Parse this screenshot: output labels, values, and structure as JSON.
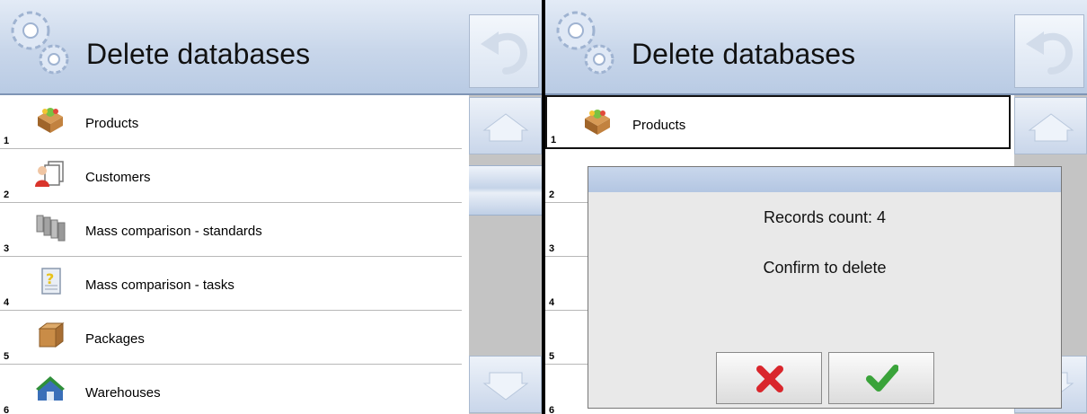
{
  "left_panel": {
    "title": "Delete databases",
    "items": [
      {
        "number": "1",
        "label": "Products",
        "icon": "products-box-icon"
      },
      {
        "number": "2",
        "label": "Customers",
        "icon": "customers-icon"
      },
      {
        "number": "3",
        "label": "Mass comparison - standards",
        "icon": "weights-icon"
      },
      {
        "number": "4",
        "label": "Mass comparison - tasks",
        "icon": "tasks-icon"
      },
      {
        "number": "5",
        "label": "Packages",
        "icon": "package-icon"
      },
      {
        "number": "6",
        "label": "Warehouses",
        "icon": "warehouse-icon"
      }
    ]
  },
  "right_panel": {
    "title": "Delete databases",
    "items": [
      {
        "number": "1",
        "label": "Products",
        "icon": "products-box-icon",
        "selected": true
      },
      {
        "number": "2"
      },
      {
        "number": "3"
      },
      {
        "number": "4"
      },
      {
        "number": "5"
      },
      {
        "number": "6"
      }
    ],
    "dialog": {
      "line1": "Records count: 4",
      "line2": "Confirm to delete",
      "cancel_icon": "red-x-icon",
      "confirm_icon": "green-check-icon"
    }
  },
  "colors": {
    "header_blue": "#c8d6ea",
    "scrollbar_gray": "#c4c4c4",
    "cancel_red": "#d9262c",
    "confirm_green": "#3aa33a"
  }
}
